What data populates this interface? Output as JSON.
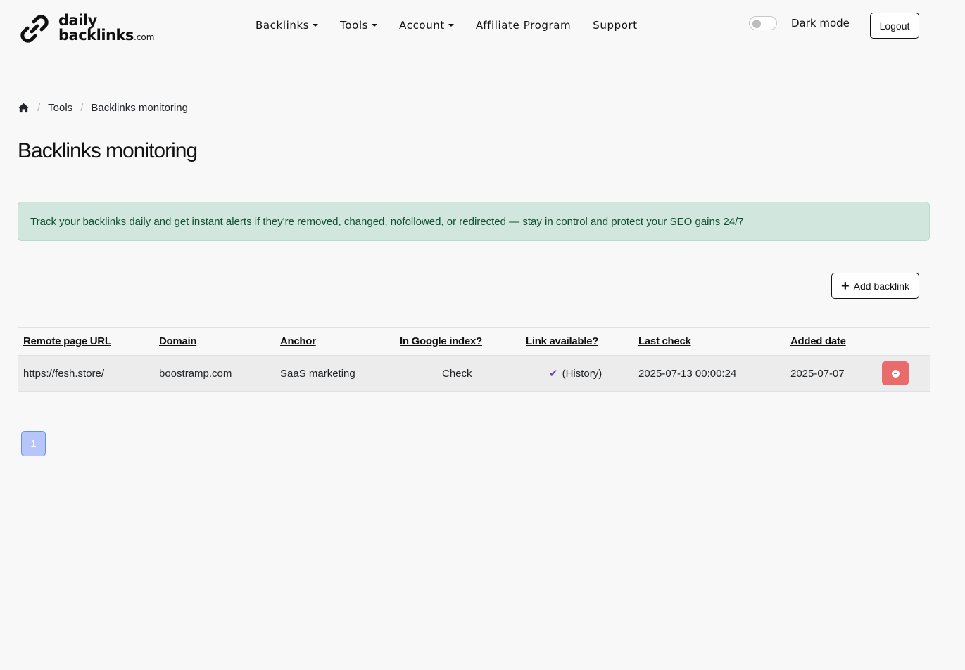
{
  "logo": {
    "line1": "daily",
    "line2": "backlinks",
    "suffix": ".com"
  },
  "nav": {
    "backlinks": "Backlinks",
    "tools": "Tools",
    "account": "Account",
    "affiliate": "Affiliate Program",
    "support": "Support"
  },
  "header": {
    "dark_mode_label": "Dark mode",
    "logout_label": "Logout"
  },
  "breadcrumb": {
    "tools": "Tools",
    "current": "Backlinks monitoring"
  },
  "page": {
    "title": "Backlinks monitoring",
    "alert": "Track your backlinks daily and get instant alerts if they're removed, changed, nofollowed, or redirected — stay in control and protect your SEO gains 24/7",
    "add_button": "Add backlink"
  },
  "table": {
    "headers": {
      "url": "Remote page URL",
      "domain": "Domain",
      "anchor": "Anchor",
      "google": "In Google index?",
      "available": "Link available?",
      "last_check": "Last check",
      "added": "Added date"
    },
    "rows": [
      {
        "url": "https://fesh.store/",
        "domain": "boostramp.com",
        "anchor": "SaaS marketing",
        "google": "Check",
        "available_icon": "✔",
        "available": "(History)",
        "last_check": "2025-07-13 00:00:24",
        "added": "2025-07-07"
      }
    ]
  },
  "pagination": {
    "current": "1"
  },
  "colors": {
    "alert_bg": "#d1e7dd",
    "alert_text": "#0f5132",
    "delete": "#ea6b6b",
    "page_active": "#b6c6fb",
    "check": "#6f42c1"
  }
}
